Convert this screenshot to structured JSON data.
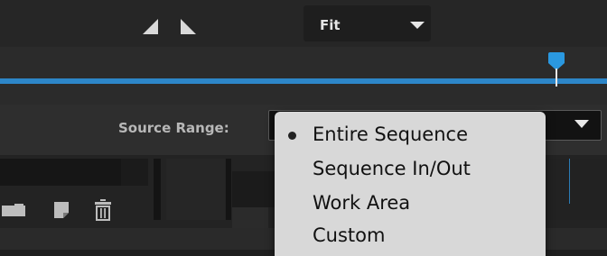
{
  "toolbar": {
    "zoom_select": {
      "value": "Fit",
      "icon": "chevron-down-icon"
    },
    "icons": [
      "trim-left-icon",
      "trim-right-icon"
    ]
  },
  "timeline": {
    "accent_color": "#2d86c8",
    "playhead_color": "#2a98e0",
    "playhead_icon": "playhead-icon"
  },
  "source_range": {
    "label": "Source Range:",
    "selected": "Entire Sequence",
    "menu": {
      "selected_index": 0,
      "items": [
        "Entire Sequence",
        "Sequence In/Out",
        "Work Area",
        "Custom"
      ]
    }
  },
  "bottom_toolbar": {
    "icons": [
      "folder-icon",
      "new-item-icon",
      "trash-icon"
    ]
  }
}
